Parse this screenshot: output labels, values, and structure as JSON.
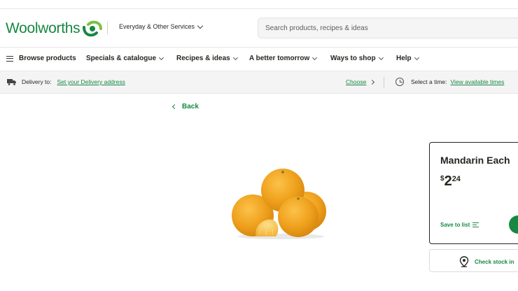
{
  "header": {
    "logo_text": "Woolworths",
    "services_label": "Everyday & Other Services",
    "search_placeholder": "Search products, recipes & ideas"
  },
  "nav": {
    "items": [
      {
        "label": "Browse products"
      },
      {
        "label": "Specials & catalogue"
      },
      {
        "label": "Recipes & ideas"
      },
      {
        "label": "A better tomorrow"
      },
      {
        "label": "Ways to shop"
      },
      {
        "label": "Help"
      }
    ]
  },
  "delivery": {
    "label": "Delivery to:",
    "address_link": "Set your Delivery address",
    "choose_link": "Choose",
    "time_label": "Select a time:",
    "time_link": "View available times"
  },
  "back_label": "Back",
  "product": {
    "name": "Mandarin Each",
    "currency": "$",
    "dollars": "2",
    "cents": "24",
    "save_to_list": "Save to list",
    "check_stock": "Check stock in"
  },
  "colors": {
    "brand_green": "#178841",
    "text_dark": "#25251f",
    "bar_bg": "#f4f4f4"
  },
  "icons": [
    "woolworths-logo-icon",
    "chevron-down-icon",
    "menu-icon",
    "truck-icon",
    "chevron-right-icon",
    "clock-icon",
    "chevron-left-icon",
    "list-icon",
    "location-pin-icon"
  ]
}
